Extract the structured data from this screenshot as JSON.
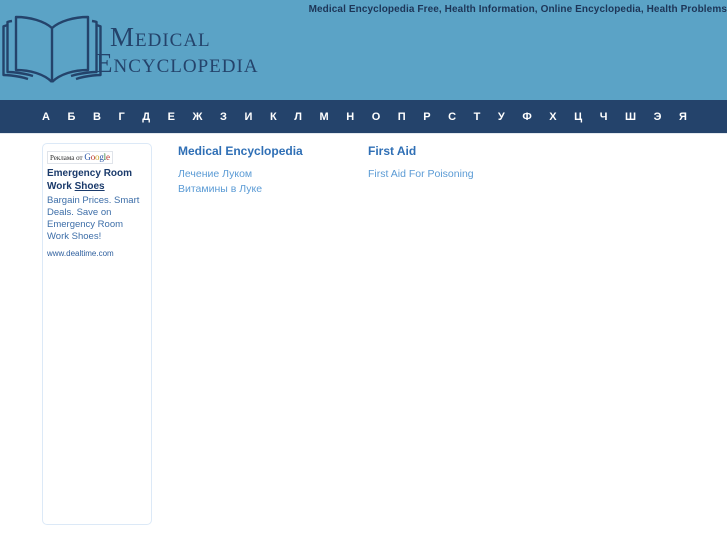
{
  "header": {
    "tagline": "Medical Encyclopedia Free, Health Information, Online Encyclopedia, Health Problems",
    "logo_line1": "Medical",
    "logo_line2": "Encyclopedia",
    "logo_icon": "open-book-icon",
    "background_color": "#5ba3c6",
    "text_color": "#24436b"
  },
  "alphabet_nav": {
    "background_color": "#24436b",
    "letters": [
      "А",
      "Б",
      "В",
      "Г",
      "Д",
      "Е",
      "Ж",
      "З",
      "И",
      "К",
      "Л",
      "М",
      "Н",
      "О",
      "П",
      "Р",
      "С",
      "Т",
      "У",
      "Ф",
      "Х",
      "Ц",
      "Ч",
      "Ш",
      "Э",
      "Я"
    ]
  },
  "ad": {
    "label_prefix": "Реклама от",
    "label_brand": "Google",
    "title_line1": "Emergency Room Work",
    "title_line2": "Shoes",
    "body": "Bargain Prices. Smart Deals. Save on Emergency Room Work Shoes!",
    "url": "www.dealtime.com",
    "border_color": "#dce9f7"
  },
  "columns": [
    {
      "heading": "Medical Encyclopedia",
      "links": [
        "Лечение Луком",
        "Витамины в Луке"
      ]
    },
    {
      "heading": "First Aid",
      "links": [
        "First Aid For Poisoning"
      ]
    }
  ],
  "colors": {
    "heading": "#2f6fb5",
    "link": "#5b9bd5"
  }
}
